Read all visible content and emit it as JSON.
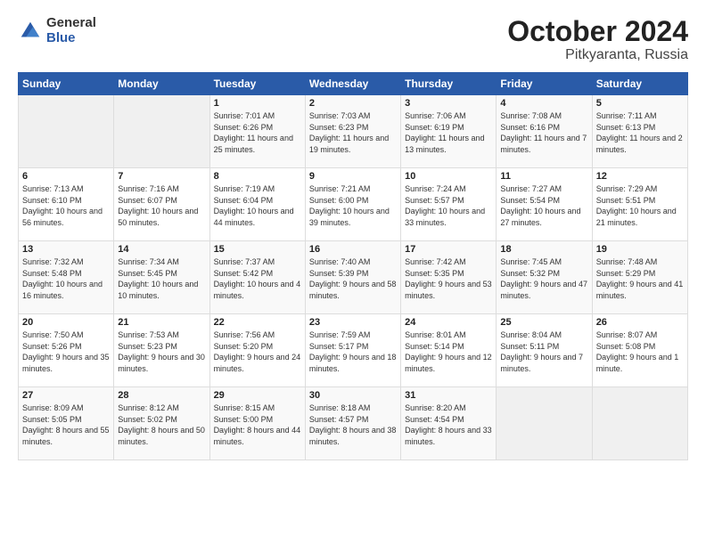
{
  "logo": {
    "general": "General",
    "blue": "Blue"
  },
  "title": {
    "month": "October 2024",
    "location": "Pitkyaranta, Russia"
  },
  "weekdays": [
    "Sunday",
    "Monday",
    "Tuesday",
    "Wednesday",
    "Thursday",
    "Friday",
    "Saturday"
  ],
  "weeks": [
    [
      {
        "day": "",
        "sunrise": "",
        "sunset": "",
        "daylight": ""
      },
      {
        "day": "",
        "sunrise": "",
        "sunset": "",
        "daylight": ""
      },
      {
        "day": "1",
        "sunrise": "Sunrise: 7:01 AM",
        "sunset": "Sunset: 6:26 PM",
        "daylight": "Daylight: 11 hours and 25 minutes."
      },
      {
        "day": "2",
        "sunrise": "Sunrise: 7:03 AM",
        "sunset": "Sunset: 6:23 PM",
        "daylight": "Daylight: 11 hours and 19 minutes."
      },
      {
        "day": "3",
        "sunrise": "Sunrise: 7:06 AM",
        "sunset": "Sunset: 6:19 PM",
        "daylight": "Daylight: 11 hours and 13 minutes."
      },
      {
        "day": "4",
        "sunrise": "Sunrise: 7:08 AM",
        "sunset": "Sunset: 6:16 PM",
        "daylight": "Daylight: 11 hours and 7 minutes."
      },
      {
        "day": "5",
        "sunrise": "Sunrise: 7:11 AM",
        "sunset": "Sunset: 6:13 PM",
        "daylight": "Daylight: 11 hours and 2 minutes."
      }
    ],
    [
      {
        "day": "6",
        "sunrise": "Sunrise: 7:13 AM",
        "sunset": "Sunset: 6:10 PM",
        "daylight": "Daylight: 10 hours and 56 minutes."
      },
      {
        "day": "7",
        "sunrise": "Sunrise: 7:16 AM",
        "sunset": "Sunset: 6:07 PM",
        "daylight": "Daylight: 10 hours and 50 minutes."
      },
      {
        "day": "8",
        "sunrise": "Sunrise: 7:19 AM",
        "sunset": "Sunset: 6:04 PM",
        "daylight": "Daylight: 10 hours and 44 minutes."
      },
      {
        "day": "9",
        "sunrise": "Sunrise: 7:21 AM",
        "sunset": "Sunset: 6:00 PM",
        "daylight": "Daylight: 10 hours and 39 minutes."
      },
      {
        "day": "10",
        "sunrise": "Sunrise: 7:24 AM",
        "sunset": "Sunset: 5:57 PM",
        "daylight": "Daylight: 10 hours and 33 minutes."
      },
      {
        "day": "11",
        "sunrise": "Sunrise: 7:27 AM",
        "sunset": "Sunset: 5:54 PM",
        "daylight": "Daylight: 10 hours and 27 minutes."
      },
      {
        "day": "12",
        "sunrise": "Sunrise: 7:29 AM",
        "sunset": "Sunset: 5:51 PM",
        "daylight": "Daylight: 10 hours and 21 minutes."
      }
    ],
    [
      {
        "day": "13",
        "sunrise": "Sunrise: 7:32 AM",
        "sunset": "Sunset: 5:48 PM",
        "daylight": "Daylight: 10 hours and 16 minutes."
      },
      {
        "day": "14",
        "sunrise": "Sunrise: 7:34 AM",
        "sunset": "Sunset: 5:45 PM",
        "daylight": "Daylight: 10 hours and 10 minutes."
      },
      {
        "day": "15",
        "sunrise": "Sunrise: 7:37 AM",
        "sunset": "Sunset: 5:42 PM",
        "daylight": "Daylight: 10 hours and 4 minutes."
      },
      {
        "day": "16",
        "sunrise": "Sunrise: 7:40 AM",
        "sunset": "Sunset: 5:39 PM",
        "daylight": "Daylight: 9 hours and 58 minutes."
      },
      {
        "day": "17",
        "sunrise": "Sunrise: 7:42 AM",
        "sunset": "Sunset: 5:35 PM",
        "daylight": "Daylight: 9 hours and 53 minutes."
      },
      {
        "day": "18",
        "sunrise": "Sunrise: 7:45 AM",
        "sunset": "Sunset: 5:32 PM",
        "daylight": "Daylight: 9 hours and 47 minutes."
      },
      {
        "day": "19",
        "sunrise": "Sunrise: 7:48 AM",
        "sunset": "Sunset: 5:29 PM",
        "daylight": "Daylight: 9 hours and 41 minutes."
      }
    ],
    [
      {
        "day": "20",
        "sunrise": "Sunrise: 7:50 AM",
        "sunset": "Sunset: 5:26 PM",
        "daylight": "Daylight: 9 hours and 35 minutes."
      },
      {
        "day": "21",
        "sunrise": "Sunrise: 7:53 AM",
        "sunset": "Sunset: 5:23 PM",
        "daylight": "Daylight: 9 hours and 30 minutes."
      },
      {
        "day": "22",
        "sunrise": "Sunrise: 7:56 AM",
        "sunset": "Sunset: 5:20 PM",
        "daylight": "Daylight: 9 hours and 24 minutes."
      },
      {
        "day": "23",
        "sunrise": "Sunrise: 7:59 AM",
        "sunset": "Sunset: 5:17 PM",
        "daylight": "Daylight: 9 hours and 18 minutes."
      },
      {
        "day": "24",
        "sunrise": "Sunrise: 8:01 AM",
        "sunset": "Sunset: 5:14 PM",
        "daylight": "Daylight: 9 hours and 12 minutes."
      },
      {
        "day": "25",
        "sunrise": "Sunrise: 8:04 AM",
        "sunset": "Sunset: 5:11 PM",
        "daylight": "Daylight: 9 hours and 7 minutes."
      },
      {
        "day": "26",
        "sunrise": "Sunrise: 8:07 AM",
        "sunset": "Sunset: 5:08 PM",
        "daylight": "Daylight: 9 hours and 1 minute."
      }
    ],
    [
      {
        "day": "27",
        "sunrise": "Sunrise: 8:09 AM",
        "sunset": "Sunset: 5:05 PM",
        "daylight": "Daylight: 8 hours and 55 minutes."
      },
      {
        "day": "28",
        "sunrise": "Sunrise: 8:12 AM",
        "sunset": "Sunset: 5:02 PM",
        "daylight": "Daylight: 8 hours and 50 minutes."
      },
      {
        "day": "29",
        "sunrise": "Sunrise: 8:15 AM",
        "sunset": "Sunset: 5:00 PM",
        "daylight": "Daylight: 8 hours and 44 minutes."
      },
      {
        "day": "30",
        "sunrise": "Sunrise: 8:18 AM",
        "sunset": "Sunset: 4:57 PM",
        "daylight": "Daylight: 8 hours and 38 minutes."
      },
      {
        "day": "31",
        "sunrise": "Sunrise: 8:20 AM",
        "sunset": "Sunset: 4:54 PM",
        "daylight": "Daylight: 8 hours and 33 minutes."
      },
      {
        "day": "",
        "sunrise": "",
        "sunset": "",
        "daylight": ""
      },
      {
        "day": "",
        "sunrise": "",
        "sunset": "",
        "daylight": ""
      }
    ]
  ]
}
